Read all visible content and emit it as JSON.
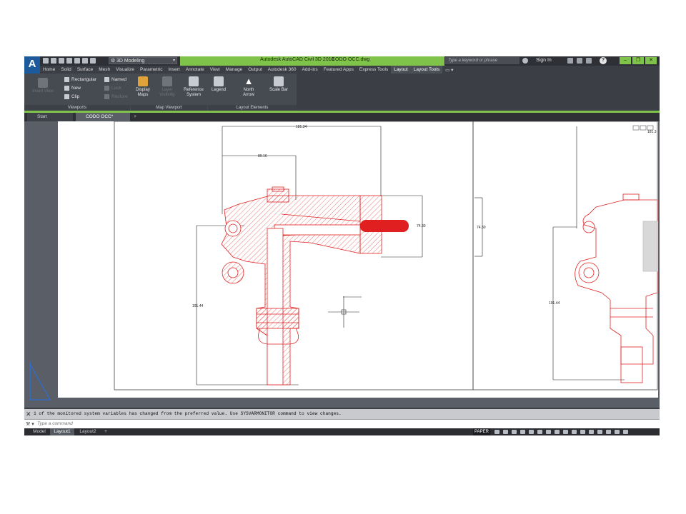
{
  "app": {
    "logo": "A",
    "workspace": "3D Modeling",
    "title": "Autodesk AutoCAD Civil 3D 2018",
    "filename": "CODO OCC.dwg",
    "search_placeholder": "Type a keyword or phrase",
    "sign_in": "Sign In",
    "help": "?",
    "win_minimize": "–",
    "win_restore": "❐",
    "win_close": "✕"
  },
  "ribbon_tabs": [
    "Home",
    "Solid",
    "Surface",
    "Mesh",
    "Visualize",
    "Parametric",
    "Insert",
    "Annotate",
    "View",
    "Manage",
    "Output",
    "Autodesk 360",
    "Add-ins",
    "Featured Apps",
    "Express Tools",
    "Layout",
    "Layout Tools"
  ],
  "ribbon_tab_extra": "▭ ▾",
  "active_tab_index": 15,
  "context_tab_index": 16,
  "panels": {
    "viewports": {
      "label": "Viewports",
      "rectangular": "Rectangular",
      "new": "New",
      "clip": "Clip",
      "named": "Named",
      "lock": "Lock",
      "restore": "Restore",
      "insert_view": "Insert View"
    },
    "map_viewport": {
      "label": "Map Viewport",
      "display_maps": "Display Maps",
      "layer_visibility": "Layer Visibility",
      "reference_system": "Reference System"
    },
    "layout_elements": {
      "label": "Layout Elements",
      "legend": "Legend",
      "north_arrow": "North Arrow",
      "scale_bar": "Scale Bar"
    }
  },
  "doc_tabs": {
    "start": "Start",
    "current": "CODO OCC*",
    "plus": "+"
  },
  "drawing": {
    "dim_top_outer": "181.34",
    "dim_top_inner": "89.16",
    "dim_right": "74.30",
    "dim_right2": "74.30",
    "dim_left": "191.44",
    "dim_left2": "191.44",
    "dim_top_right": "181.3"
  },
  "command": {
    "message": "1 of the monitored system variables has changed from the preferred value. Use SYSVARMONITOR command to view changes.",
    "placeholder": "Type a command",
    "close": "✕"
  },
  "status": {
    "model": "Model",
    "layout1": "Layout1",
    "layout2": "Layout2",
    "plus": "+",
    "paper": "PAPER"
  },
  "colors": {
    "accent_green": "#7fc34a",
    "drawing_red": "#e02020",
    "ui_dark": "#3b3e44"
  }
}
